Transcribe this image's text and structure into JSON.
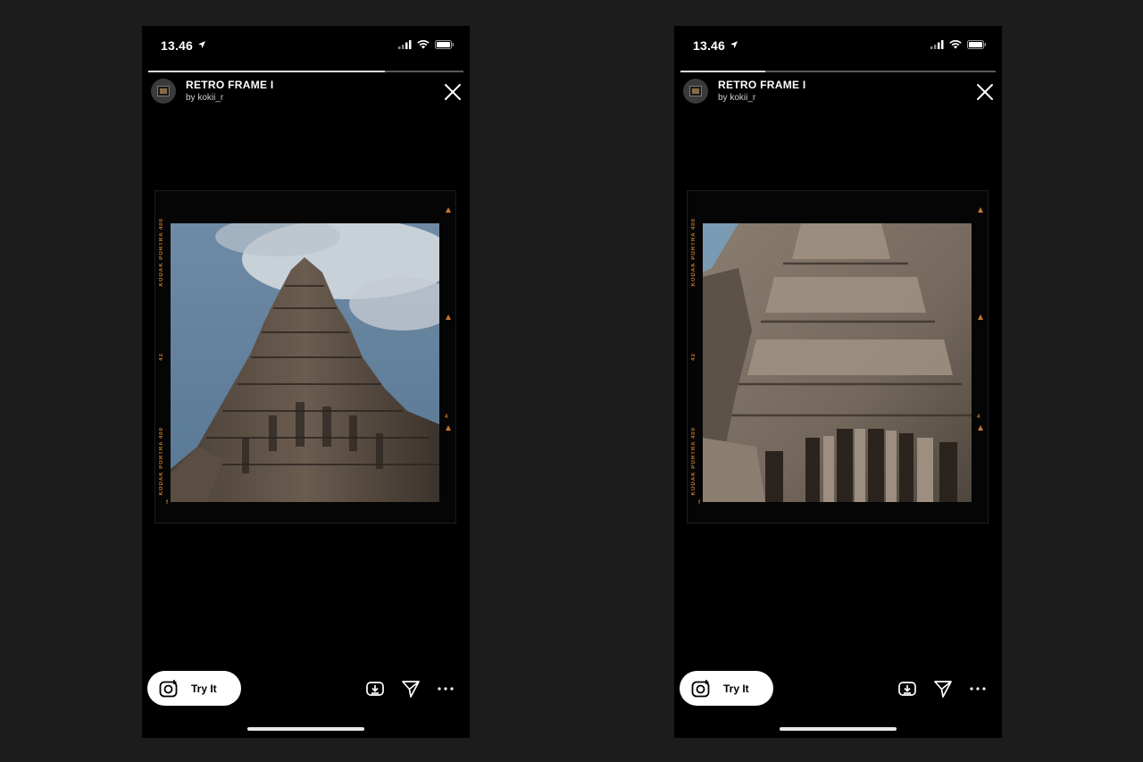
{
  "screens": [
    {
      "id": "left",
      "status": {
        "time": "13.46"
      },
      "story": {
        "title": "RETRO FRAME I",
        "author": "by kokii_r",
        "progress": 0.75
      },
      "film": {
        "left_texts": [
          "KODAK PORTRA 400",
          "42",
          "KODAK PORTRA 400"
        ],
        "right_marks": [
          "",
          "",
          "4",
          "",
          "f"
        ]
      },
      "actions": {
        "try_it_label": "Try It"
      }
    },
    {
      "id": "right",
      "status": {
        "time": "13.46"
      },
      "story": {
        "title": "RETRO FRAME I",
        "author": "by kokii_r",
        "progress": 0.27
      },
      "film": {
        "left_texts": [
          "KODAK PORTRA 400",
          "42",
          "KODAK PORTRA 400"
        ],
        "right_marks": [
          "",
          "",
          "4",
          "",
          "f"
        ]
      },
      "actions": {
        "try_it_label": "Try It"
      }
    }
  ],
  "colors": {
    "background": "#1c1c1c",
    "phone": "#000000",
    "film_accent": "#c27a2e"
  }
}
